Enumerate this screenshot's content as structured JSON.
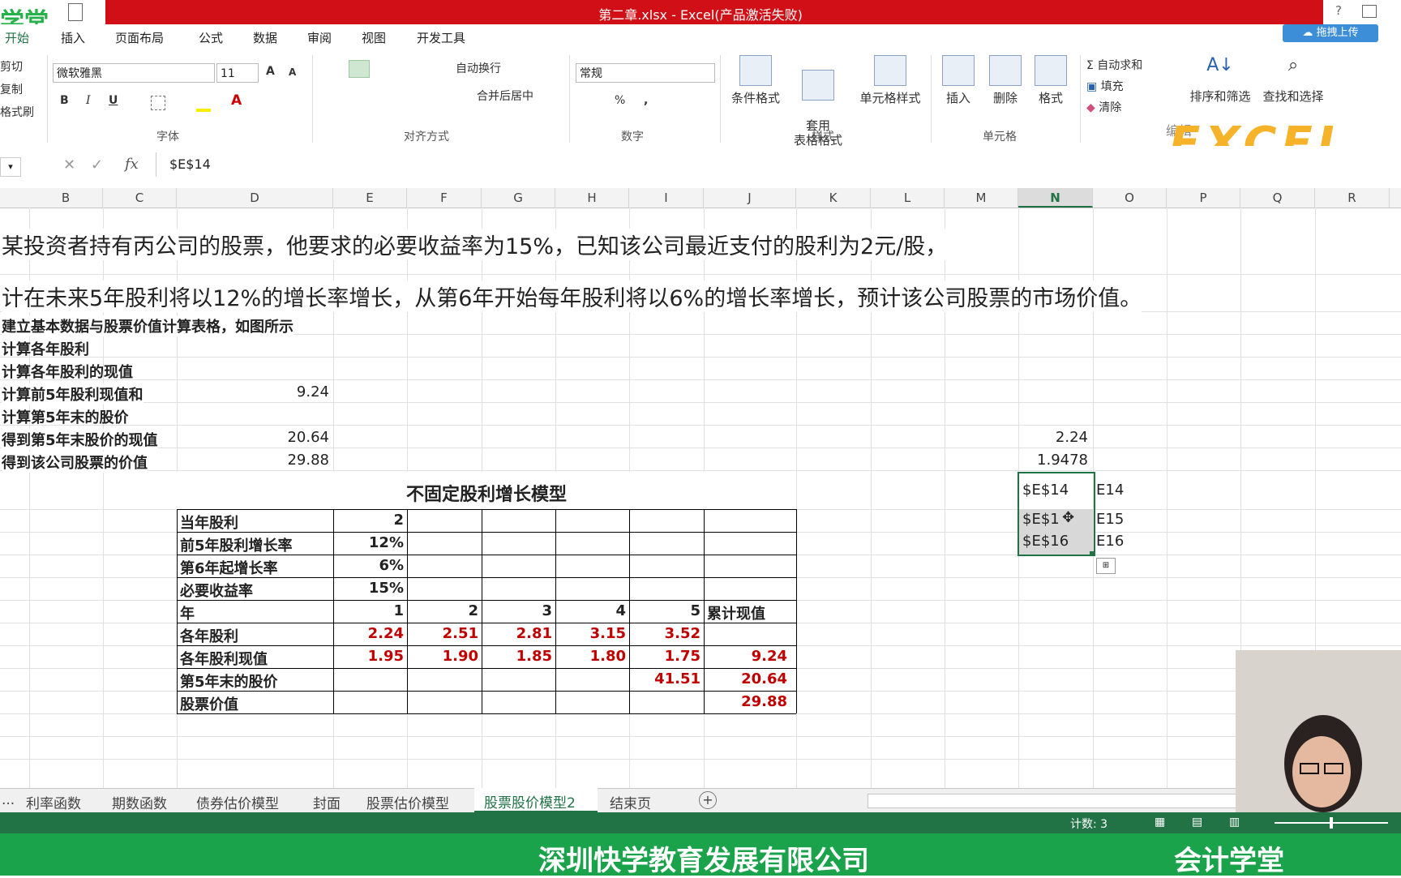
{
  "window": {
    "title": "第二章.xlsx -  Excel(产品激活失败)",
    "help": "?",
    "logo": "学堂"
  },
  "ribbon_tabs": [
    "开始",
    "插入",
    "页面布局",
    "公式",
    "数据",
    "审阅",
    "视图",
    "开发工具"
  ],
  "upload_button": "拖拽上传",
  "clipboard": {
    "cut": "剪切",
    "copy": "复制",
    "format_painter": "格式刷"
  },
  "font": {
    "name": "微软雅黑",
    "size": "11",
    "group": "字体",
    "bold": "B",
    "italic": "I",
    "underline": "U"
  },
  "alignment": {
    "wrap": "自动换行",
    "merge": "合并后居中",
    "group": "对齐方式"
  },
  "number": {
    "format": "常规",
    "group": "数字",
    "percent": "%",
    "comma": ","
  },
  "styles": {
    "conditional": "条件格式",
    "table_format": "套用\n表格格式",
    "cell_styles": "单元格样式",
    "group": "样式"
  },
  "cells": {
    "insert": "插入",
    "delete": "删除",
    "format": "格式",
    "group": "单元格"
  },
  "editing": {
    "autosum": "自动求和",
    "fill": "填充",
    "clear": "清除",
    "sort": "排序和筛选",
    "find": "查找和选择",
    "group": "编辑"
  },
  "excel_logo": "EXCEL",
  "formula_bar": {
    "fx": "fx",
    "formula": "$E$14"
  },
  "columns": [
    "B",
    "C",
    "D",
    "E",
    "F",
    "G",
    "H",
    "I",
    "J",
    "K",
    "L",
    "M",
    "N",
    "O",
    "P",
    "Q",
    "R"
  ],
  "sheet": {
    "line1": "某投资者持有丙公司的股票，他要求的必要收益率为15%，已知该公司最近支付的股利为2元/股，",
    "line2": "计在未来5年股利将以12%的增长率增长，从第6年开始每年股利将以6%的增长率增长，预计该公司股票的市场价值。",
    "steps": [
      {
        "label": "建立基本数据与股票价值计算表格，如图所示",
        "value": ""
      },
      {
        "label": "计算各年股利",
        "value": ""
      },
      {
        "label": "计算各年股利的现值",
        "value": ""
      },
      {
        "label": "计算前5年股利现值和",
        "value": "9.24"
      },
      {
        "label": "计算第5年末的股价",
        "value": ""
      },
      {
        "label": "得到第5年末股价的现值",
        "value": "20.64"
      },
      {
        "label": "得到该公司股票的价值",
        "value": "29.88"
      }
    ],
    "n_values": [
      "2.24",
      "1.9478"
    ],
    "n_refs": [
      "$E$14",
      "$E$1",
      "$E$16"
    ],
    "o_refs": [
      "E14",
      "E15",
      "E16"
    ],
    "table_title": "不固定股利增长模型",
    "table": {
      "params": [
        {
          "label": "当年股利",
          "value": "2"
        },
        {
          "label": "前5年股利增长率",
          "value": "12%"
        },
        {
          "label": "第6年起增长率",
          "value": "6%"
        },
        {
          "label": "必要收益率",
          "value": "15%"
        }
      ],
      "year_label": "年",
      "years": [
        "1",
        "2",
        "3",
        "4",
        "5"
      ],
      "cumulative_label": "累计现值",
      "dividends_label": "各年股利",
      "dividends": [
        "2.24",
        "2.51",
        "2.81",
        "3.15",
        "3.52"
      ],
      "pv_label": "各年股利现值",
      "pv": [
        "1.95",
        "1.90",
        "1.85",
        "1.80",
        "1.75"
      ],
      "pv_total": "9.24",
      "price5_label": "第5年末的股价",
      "price5": "41.51",
      "price5_pv": "20.64",
      "value_label": "股票价值",
      "value": "29.88"
    }
  },
  "sheet_tabs": [
    "...",
    "利率函数",
    "期数函数",
    "债券估价模型",
    "封面",
    "股票估价模型",
    "股票股价模型2",
    "结束页"
  ],
  "active_sheet": "股票股价模型2",
  "status": {
    "count": "计数: 3"
  },
  "banner": {
    "company": "深圳快学教育发展有限公司",
    "brand": "会计学堂"
  },
  "colors": {
    "title_red": "#d10f16",
    "excel_green": "#217346",
    "banner_green": "#1aa34a",
    "data_red": "#c00000"
  }
}
